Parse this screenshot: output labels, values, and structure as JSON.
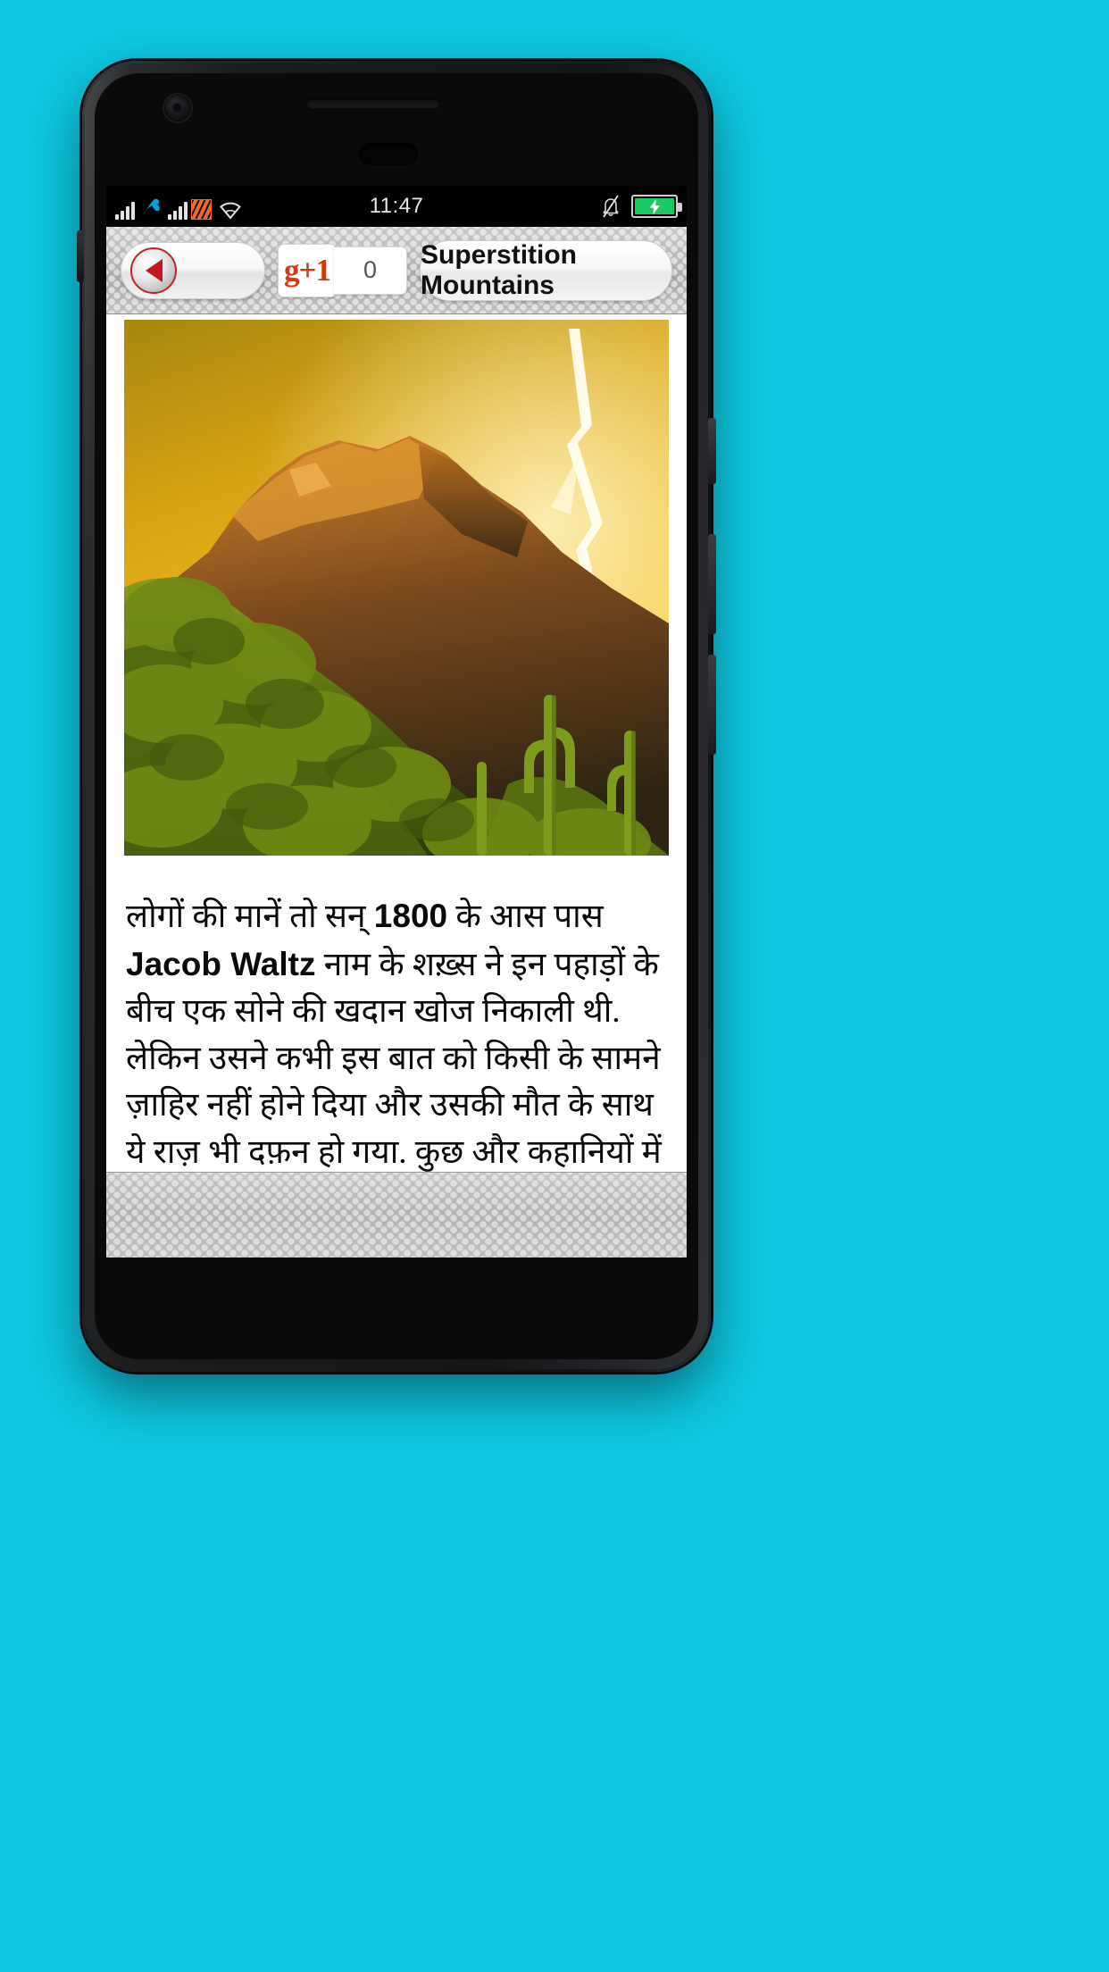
{
  "device": {
    "frame_color": "#1b1d1f",
    "background_color": "#0ec7e0"
  },
  "status_bar": {
    "time": "11:47",
    "icons": {
      "signal_1": "signal-bars-icon",
      "carrier": "telenor-logo-icon",
      "signal_2": "signal-bars-icon",
      "roaming": "roaming-data-icon",
      "wifi": "wifi-icon",
      "notification": "bell-muted-icon",
      "battery": "battery-charging-icon"
    },
    "battery_state": "charging",
    "battery_color": "#18c964"
  },
  "toolbar": {
    "back_label": "back-arrow",
    "gplus_label": "g+1",
    "gplus_count": "0",
    "page_title": "Superstition Mountains"
  },
  "article": {
    "image_alt": "Superstition Mountains with lightning at sunset",
    "paragraph_pre": "लोगों की मानें तो सन् ",
    "paragraph_year": "1800",
    "paragraph_mid": " के आस पास ",
    "paragraph_name": "Jacob Waltz",
    "paragraph_rest": " नाम के शख़्स ने इन पहाड़ों के बीच एक सोने की खदान खोज निकाली थी. लेकिन उसने कभी इस बात को किसी के सामने ज़ाहिर नहीं होने दिया और उसकी मौत के साथ ये राज़ भी दफ़न हो गया. कुछ और कहानियों में कहा गया है कि उस सोने की खदान को खोजने के चक्कर में बहुत लोगों ने अपनी जान गवांई है. लेकिन उसकी रूह आज भी उसकी तलाश में"
  }
}
